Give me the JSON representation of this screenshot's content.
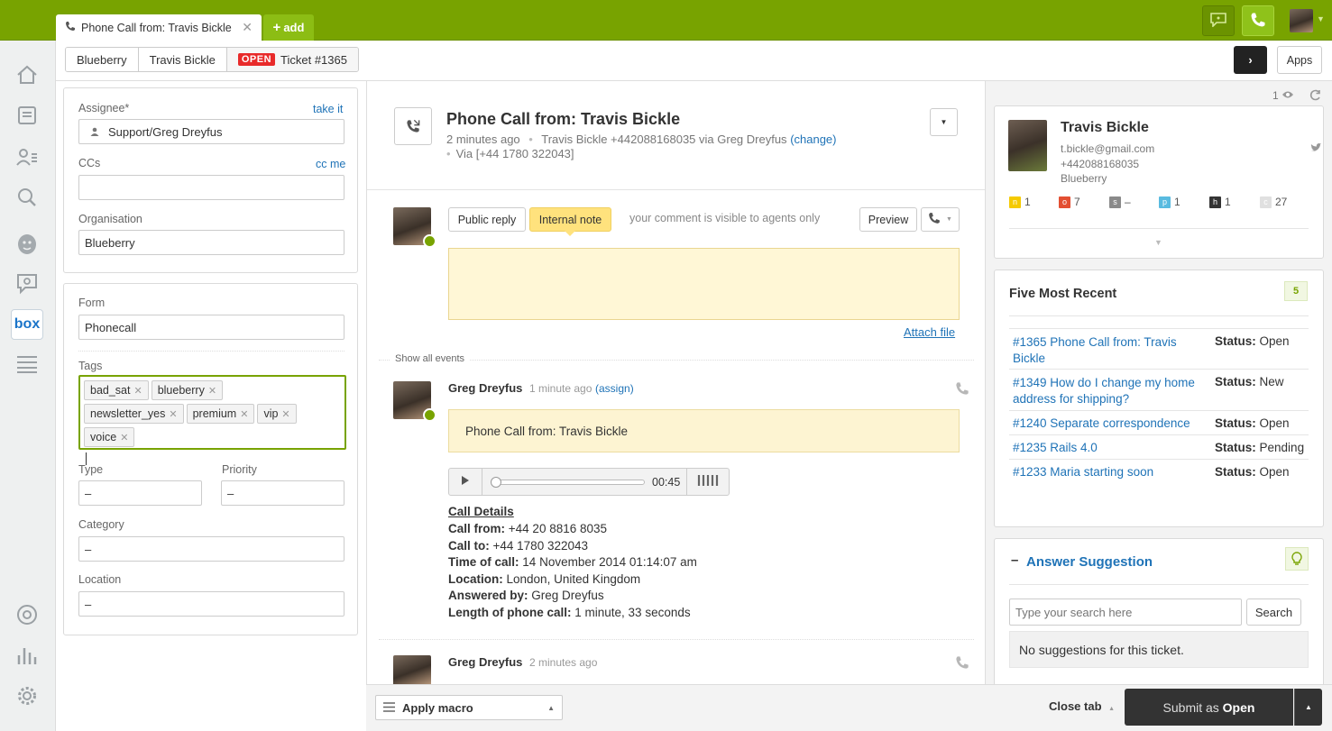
{
  "tab": {
    "title": "Phone Call from: Travis Bickle",
    "add_label": "add"
  },
  "breadcrumbs": {
    "org": "Blueberry",
    "user": "Travis Bickle",
    "status_badge": "OPEN",
    "ticket": "Ticket #1365"
  },
  "apps_label": "Apps",
  "properties": {
    "assignee_label": "Assignee*",
    "take_it": "take it",
    "assignee_value": "Support/Greg Dreyfus",
    "ccs_label": "CCs",
    "cc_me": "cc me",
    "org_label": "Organisation",
    "org_value": "Blueberry",
    "form_label": "Form",
    "form_value": "Phonecall",
    "tags_label": "Tags",
    "tags": [
      "bad_sat",
      "blueberry",
      "newsletter_yes",
      "premium",
      "vip",
      "voice"
    ],
    "type_label": "Type",
    "type_value": "–",
    "priority_label": "Priority",
    "priority_value": "–",
    "category_label": "Category",
    "category_value": "–",
    "location_label": "Location",
    "location_value": "–"
  },
  "ticket": {
    "title": "Phone Call from: Travis Bickle",
    "time": "2 minutes ago",
    "meta": "Travis Bickle +442088168035 via Greg Dreyfus",
    "change": "(change)",
    "via": "Via [+44 1780 322043]"
  },
  "composer": {
    "public_reply": "Public reply",
    "internal_note": "Internal note",
    "visibility": "your comment is visible to agents only",
    "preview": "Preview",
    "attach": "Attach file"
  },
  "events": {
    "show_all": "Show all events",
    "e1_author": "Greg Dreyfus",
    "e1_time": "1 minute ago",
    "e1_assign": "(assign)",
    "e1_note": "Phone Call from: Travis Bickle",
    "audio_time": "00:45",
    "details_title": "Call Details",
    "details": [
      {
        "label": "Call from:",
        "value": "+44 20 8816 8035"
      },
      {
        "label": "Call to:",
        "value": "+44 1780 322043"
      },
      {
        "label": "Time of call:",
        "value": "14 November 2014 01:14:07 am"
      },
      {
        "label": "Location:",
        "value": "London, United Kingdom"
      },
      {
        "label": "Answered by:",
        "value": "Greg Dreyfus"
      },
      {
        "label": "Length of phone call:",
        "value": "1 minute, 33 seconds"
      }
    ],
    "e2_author": "Greg Dreyfus",
    "e2_time": "2 minutes ago"
  },
  "viewers": "1",
  "user_card": {
    "name": "Travis Bickle",
    "email": "t.bickle@gmail.com",
    "phone": "+442088168035",
    "org": "Blueberry",
    "stats": [
      {
        "letter": "n",
        "count": "1",
        "color": "#f5ca00"
      },
      {
        "letter": "o",
        "count": "7",
        "color": "#e34f32"
      },
      {
        "letter": "s",
        "count": "–",
        "color": "#8a8a8a"
      },
      {
        "letter": "p",
        "count": "1",
        "color": "#59bbe0"
      },
      {
        "letter": "h",
        "count": "1",
        "color": "#333333"
      },
      {
        "letter": "c",
        "count": "27",
        "color": "#e0e0e0"
      }
    ]
  },
  "recent": {
    "title": "Five Most Recent",
    "badge": "5",
    "status_label": "Status:",
    "items": [
      {
        "ticket": "#1365 Phone Call from: Travis Bickle",
        "status": "Open"
      },
      {
        "ticket": "#1349 How do I change my home address for shipping?",
        "status": "New"
      },
      {
        "ticket": "#1240 Separate correspondence",
        "status": "Open"
      },
      {
        "ticket": "#1235 Rails 4.0",
        "status": "Pending"
      },
      {
        "ticket": "#1233 Maria starting soon",
        "status": "Open"
      }
    ]
  },
  "answer": {
    "collapse": "–",
    "title": "Answer Suggestion",
    "search_placeholder": "Type your search here",
    "search_btn": "Search",
    "no_suggestions": "No suggestions for this ticket."
  },
  "bottom": {
    "macro": "Apply macro",
    "close_tab": "Close tab",
    "submit_prefix": "Submit as",
    "submit_status": "Open"
  }
}
